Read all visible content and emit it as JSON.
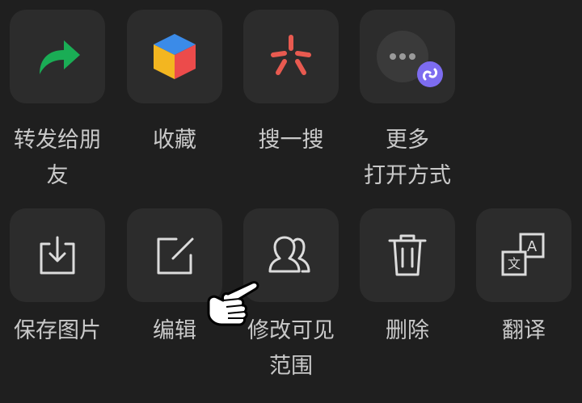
{
  "actions_row1": [
    {
      "label": "转发给朋\n友",
      "icon": "forward-arrow-icon"
    },
    {
      "label": "收藏",
      "icon": "favorite-cube-icon"
    },
    {
      "label": "搜一搜",
      "icon": "search-spark-icon"
    },
    {
      "label": "更多\n打开方式",
      "icon": "more-open-with-icon"
    }
  ],
  "actions_row2": [
    {
      "label": "保存图片",
      "icon": "save-image-icon"
    },
    {
      "label": "编辑",
      "icon": "edit-icon"
    },
    {
      "label": "修改可见\n范围",
      "icon": "visibility-range-icon"
    },
    {
      "label": "删除",
      "icon": "delete-trash-icon"
    },
    {
      "label": "翻译",
      "icon": "translate-icon"
    }
  ],
  "colors": {
    "background": "#1f1f1f",
    "tile": "#2c2c2c",
    "label": "#c9c9c9",
    "forward_green": "#1aad55",
    "spark_red": "#e85a50",
    "mini_program_purple": "#7d6cf0"
  }
}
